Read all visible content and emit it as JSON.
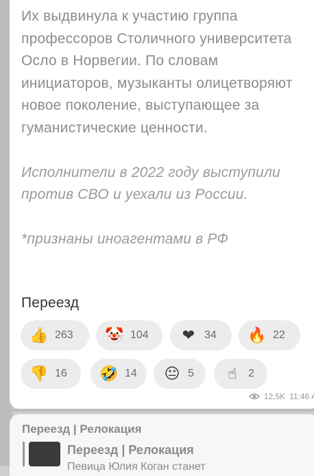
{
  "post": {
    "paragraphs": [
      "Их выдвинула к участию группа профессоров Столичного университета Осло в Норвегии. По словам инициаторов, музыканты олицетворяют новое поколение, выступающее за гуманистические ценности.",
      "Исполнители в 2022 году выступили против СВО и уехали из России.",
      "*признаны иноагентами в РФ"
    ],
    "signature": "Переезд"
  },
  "reactions": [
    {
      "icon": "thumbs-up-icon",
      "count": "263"
    },
    {
      "icon": "clown-icon",
      "count": "104"
    },
    {
      "icon": "heart-icon",
      "count": "34"
    },
    {
      "icon": "fire-icon",
      "count": "22"
    },
    {
      "icon": "thumbs-down-icon",
      "count": "16"
    },
    {
      "icon": "rofl-icon",
      "count": "14"
    },
    {
      "icon": "neutral-face-icon",
      "count": "5"
    },
    {
      "icon": "pointing-hand-icon",
      "count": "2"
    }
  ],
  "meta": {
    "views": "12,5K",
    "time": "11:46 A"
  },
  "next_message": {
    "channel": "Переезд | Релокация",
    "reply_name": "Переезд | Релокация",
    "reply_snippet": "Певица Юлия Коган станет"
  },
  "colors": {
    "background": "#cfcfcf",
    "bubble": "#ffffff",
    "reaction_pill": "#ececec",
    "text": "#8c8c8c"
  }
}
